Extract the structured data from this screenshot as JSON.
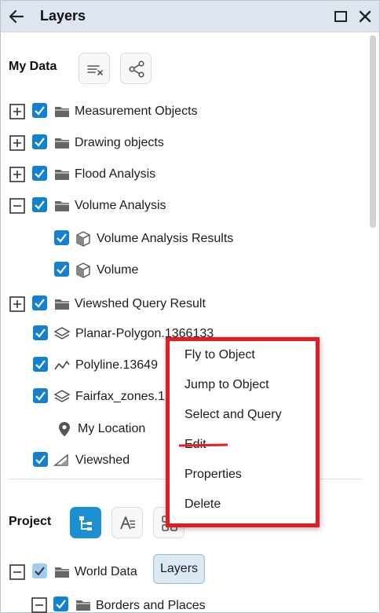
{
  "panel": {
    "title": "Layers",
    "back_icon": "arrow-left-icon",
    "maximize_icon": "maximize-icon",
    "close_icon": "close-icon"
  },
  "my_data": {
    "title": "My Data",
    "tools": [
      "clear-list-icon",
      "share-icon"
    ],
    "items": [
      {
        "label": "Measurement Objects",
        "expander": "plus",
        "checked": true,
        "icon": "folder-icon"
      },
      {
        "label": "Drawing objects",
        "expander": "plus",
        "checked": true,
        "icon": "folder-icon"
      },
      {
        "label": "Flood Analysis",
        "expander": "plus",
        "checked": true,
        "icon": "folder-icon"
      },
      {
        "label": "Volume Analysis",
        "expander": "minus",
        "checked": true,
        "icon": "folder-icon"
      },
      {
        "label": "Volume Analysis Results",
        "checked": true,
        "icon": "cube-icon"
      },
      {
        "label": "Volume",
        "checked": true,
        "icon": "cube-icon"
      },
      {
        "label": "Viewshed Query Result",
        "expander": "plus",
        "checked": true,
        "icon": "folder-icon"
      },
      {
        "label": "Planar-Polygon.1366133",
        "checked": true,
        "icon": "layers-icon"
      },
      {
        "label": "Polyline.13649",
        "checked": true,
        "icon": "polyline-icon"
      },
      {
        "label": "Fairfax_zones.1",
        "checked": true,
        "icon": "layers-icon"
      },
      {
        "label": "My Location",
        "checked": false,
        "icon": "location-pin-icon"
      },
      {
        "label": "Viewshed",
        "checked": true,
        "icon": "viewshed-icon"
      }
    ]
  },
  "context_menu": {
    "items": [
      "Fly to Object",
      "Jump to Object",
      "Select and Query",
      "Edit",
      "Properties",
      "Delete"
    ],
    "struck_item": "Edit",
    "highlight_color": "#e31c24"
  },
  "project": {
    "title": "Project",
    "tools": [
      "tree-view-icon",
      "text-style-icon",
      "grid-view-icon"
    ],
    "tooltip": "Layers",
    "items": [
      {
        "label": "World Data",
        "expander": "minus",
        "checked": true,
        "partial": true,
        "icon": "folder-icon"
      },
      {
        "label": "Borders and Places",
        "expander": "minus",
        "checked": true,
        "icon": "folder-icon"
      }
    ]
  },
  "colors": {
    "accent": "#1480d0",
    "header_bg": "#dde6ef",
    "active_tool": "#1b8fd1"
  }
}
